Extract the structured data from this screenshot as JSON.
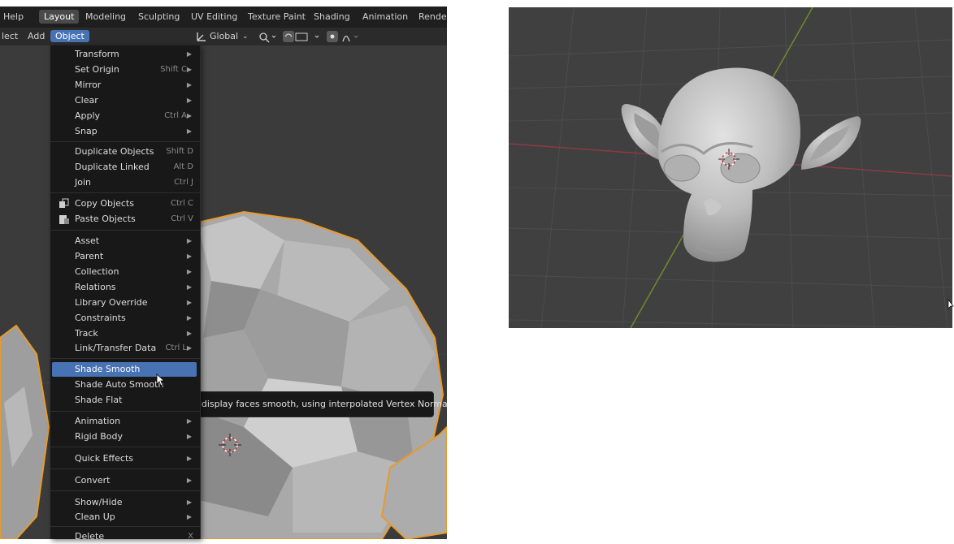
{
  "workspace_tabs": {
    "help": "Help",
    "layout": "Layout",
    "modeling": "Modeling",
    "sculpting": "Sculpting",
    "uv_editing": "UV Editing",
    "texture_paint": "Texture Paint",
    "shading": "Shading",
    "animation": "Animation",
    "rendering": "Render"
  },
  "header": {
    "select": "lect",
    "add": "Add",
    "object": "Object",
    "transform_orientation": "Global"
  },
  "menu": {
    "items": [
      {
        "label": "Transform",
        "shortcut": "",
        "submenu": true
      },
      {
        "label": "Set Origin",
        "shortcut": "Shift C",
        "submenu": true
      },
      {
        "label": "Mirror",
        "shortcut": "",
        "submenu": true
      },
      {
        "label": "Clear",
        "shortcut": "",
        "submenu": true
      },
      {
        "label": "Apply",
        "shortcut": "Ctrl A",
        "submenu": true
      },
      {
        "label": "Snap",
        "shortcut": "",
        "submenu": true
      },
      {
        "label": "Duplicate Objects",
        "shortcut": "Shift D",
        "submenu": false
      },
      {
        "label": "Duplicate Linked",
        "shortcut": "Alt D",
        "submenu": false
      },
      {
        "label": "Join",
        "shortcut": "Ctrl J",
        "submenu": false
      },
      {
        "label": "Copy Objects",
        "shortcut": "Ctrl C",
        "submenu": false,
        "icon": "copy-icon"
      },
      {
        "label": "Paste Objects",
        "shortcut": "Ctrl V",
        "submenu": false,
        "icon": "paste-icon"
      },
      {
        "label": "Asset",
        "shortcut": "",
        "submenu": true
      },
      {
        "label": "Parent",
        "shortcut": "",
        "submenu": true
      },
      {
        "label": "Collection",
        "shortcut": "",
        "submenu": true
      },
      {
        "label": "Relations",
        "shortcut": "",
        "submenu": true
      },
      {
        "label": "Library Override",
        "shortcut": "",
        "submenu": true
      },
      {
        "label": "Constraints",
        "shortcut": "",
        "submenu": true
      },
      {
        "label": "Track",
        "shortcut": "",
        "submenu": true
      },
      {
        "label": "Link/Transfer Data",
        "shortcut": "Ctrl L",
        "submenu": true
      },
      {
        "label": "Shade Smooth",
        "shortcut": "",
        "submenu": false,
        "highlighted": true
      },
      {
        "label": "Shade Auto Smooth",
        "shortcut": "",
        "submenu": false
      },
      {
        "label": "Shade Flat",
        "shortcut": "",
        "submenu": false
      },
      {
        "label": "Animation",
        "shortcut": "",
        "submenu": true
      },
      {
        "label": "Rigid Body",
        "shortcut": "",
        "submenu": true
      },
      {
        "label": "Quick Effects",
        "shortcut": "",
        "submenu": true
      },
      {
        "label": "Convert",
        "shortcut": "",
        "submenu": true
      },
      {
        "label": "Show/Hide",
        "shortcut": "",
        "submenu": true
      },
      {
        "label": "Clean Up",
        "shortcut": "",
        "submenu": true
      },
      {
        "label": "Delete",
        "shortcut": "X",
        "submenu": false
      }
    ]
  },
  "tooltip": {
    "text": "Render and display faces smooth, using interpolated Vertex Normals."
  },
  "colors": {
    "accent": "#4772b3",
    "selection_outline": "#e89a2c",
    "menu_bg": "#181818"
  }
}
